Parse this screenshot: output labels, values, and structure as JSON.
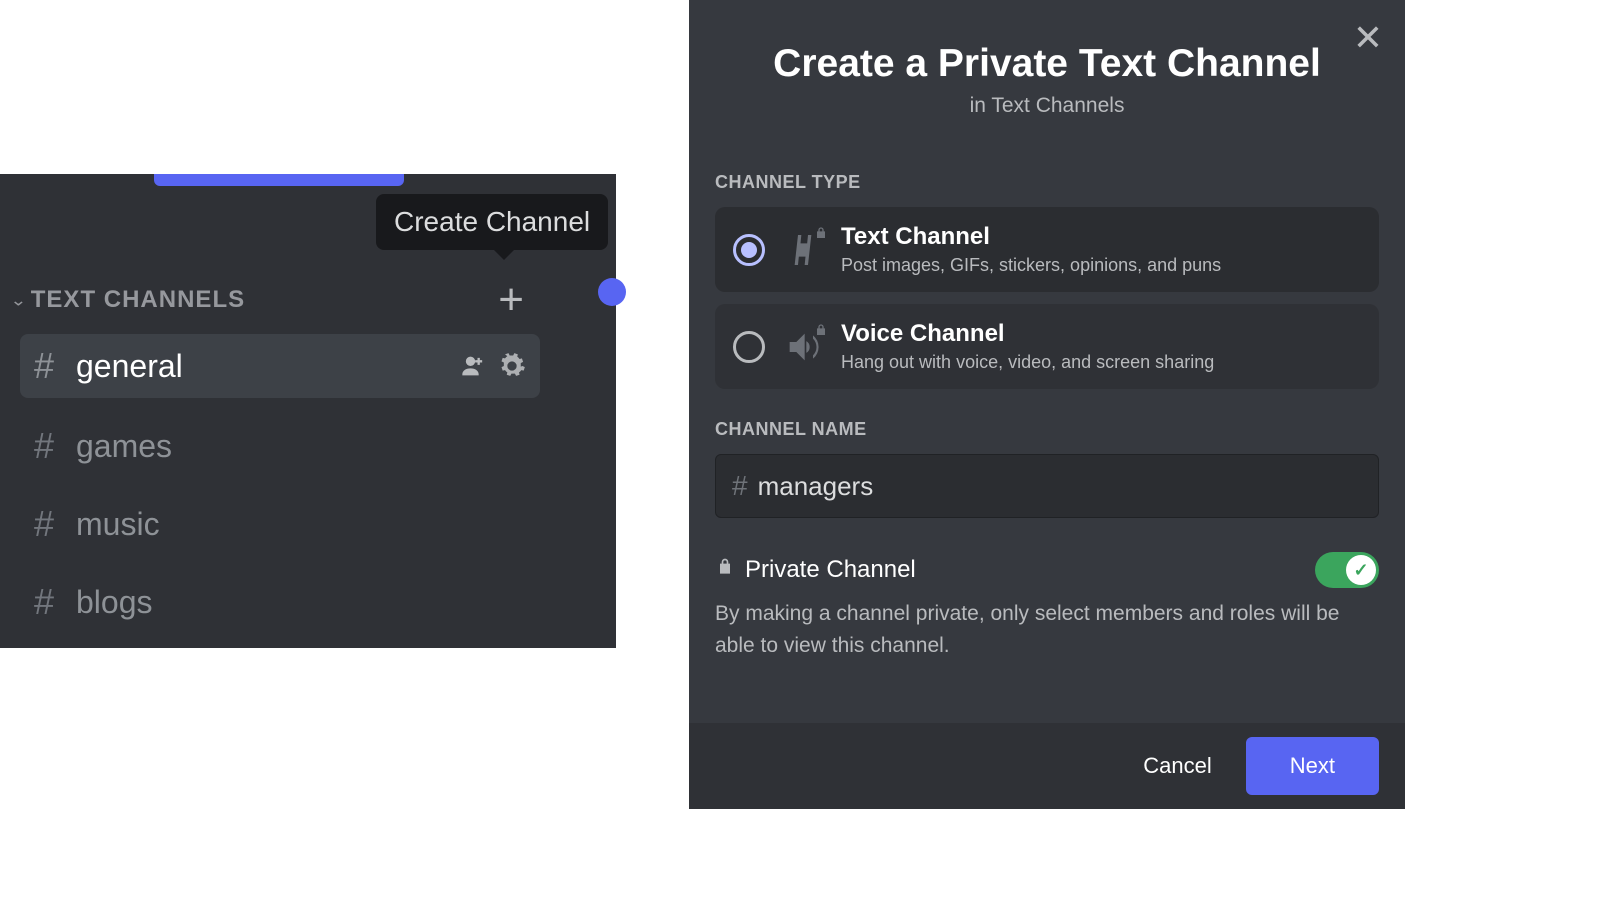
{
  "sidebar": {
    "tooltip": "Create Channel",
    "category_label": "TEXT CHANNELS",
    "channels": [
      {
        "name": "general",
        "selected": true
      },
      {
        "name": "games",
        "selected": false
      },
      {
        "name": "music",
        "selected": false
      },
      {
        "name": "blogs",
        "selected": false
      }
    ]
  },
  "modal": {
    "title": "Create a Private Text Channel",
    "subtitle": "in Text Channels",
    "section_type": "CHANNEL TYPE",
    "types": [
      {
        "title": "Text Channel",
        "desc": "Post images, GIFs, stickers, opinions, and puns",
        "selected": true
      },
      {
        "title": "Voice Channel",
        "desc": "Hang out with voice, video, and screen sharing",
        "selected": false
      }
    ],
    "section_name": "CHANNEL NAME",
    "channel_name_value": "managers",
    "private_label": "Private Channel",
    "private_enabled": true,
    "private_desc": "By making a channel private, only select members and roles will be able to view this channel.",
    "btn_cancel": "Cancel",
    "btn_next": "Next"
  }
}
